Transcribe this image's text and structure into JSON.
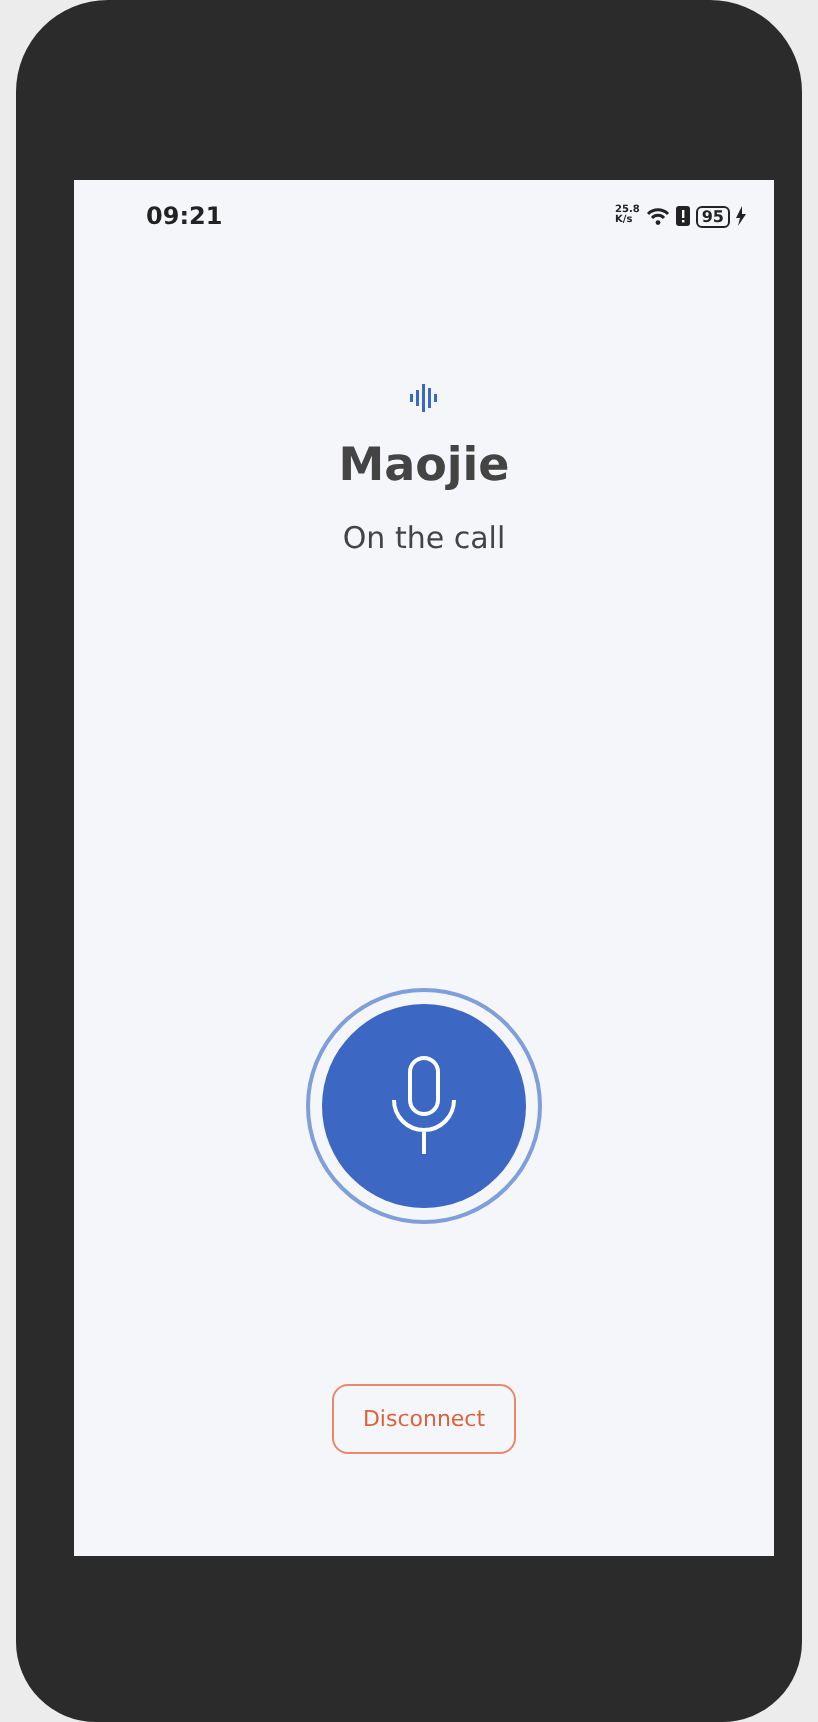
{
  "status_bar": {
    "time": "09:21",
    "net_speed": "25.8",
    "net_unit": "K/s",
    "battery": "95",
    "charging": true
  },
  "call": {
    "name": "Maojie",
    "status": "On the call"
  },
  "disconnect_button": {
    "label": "Disconnect"
  }
}
